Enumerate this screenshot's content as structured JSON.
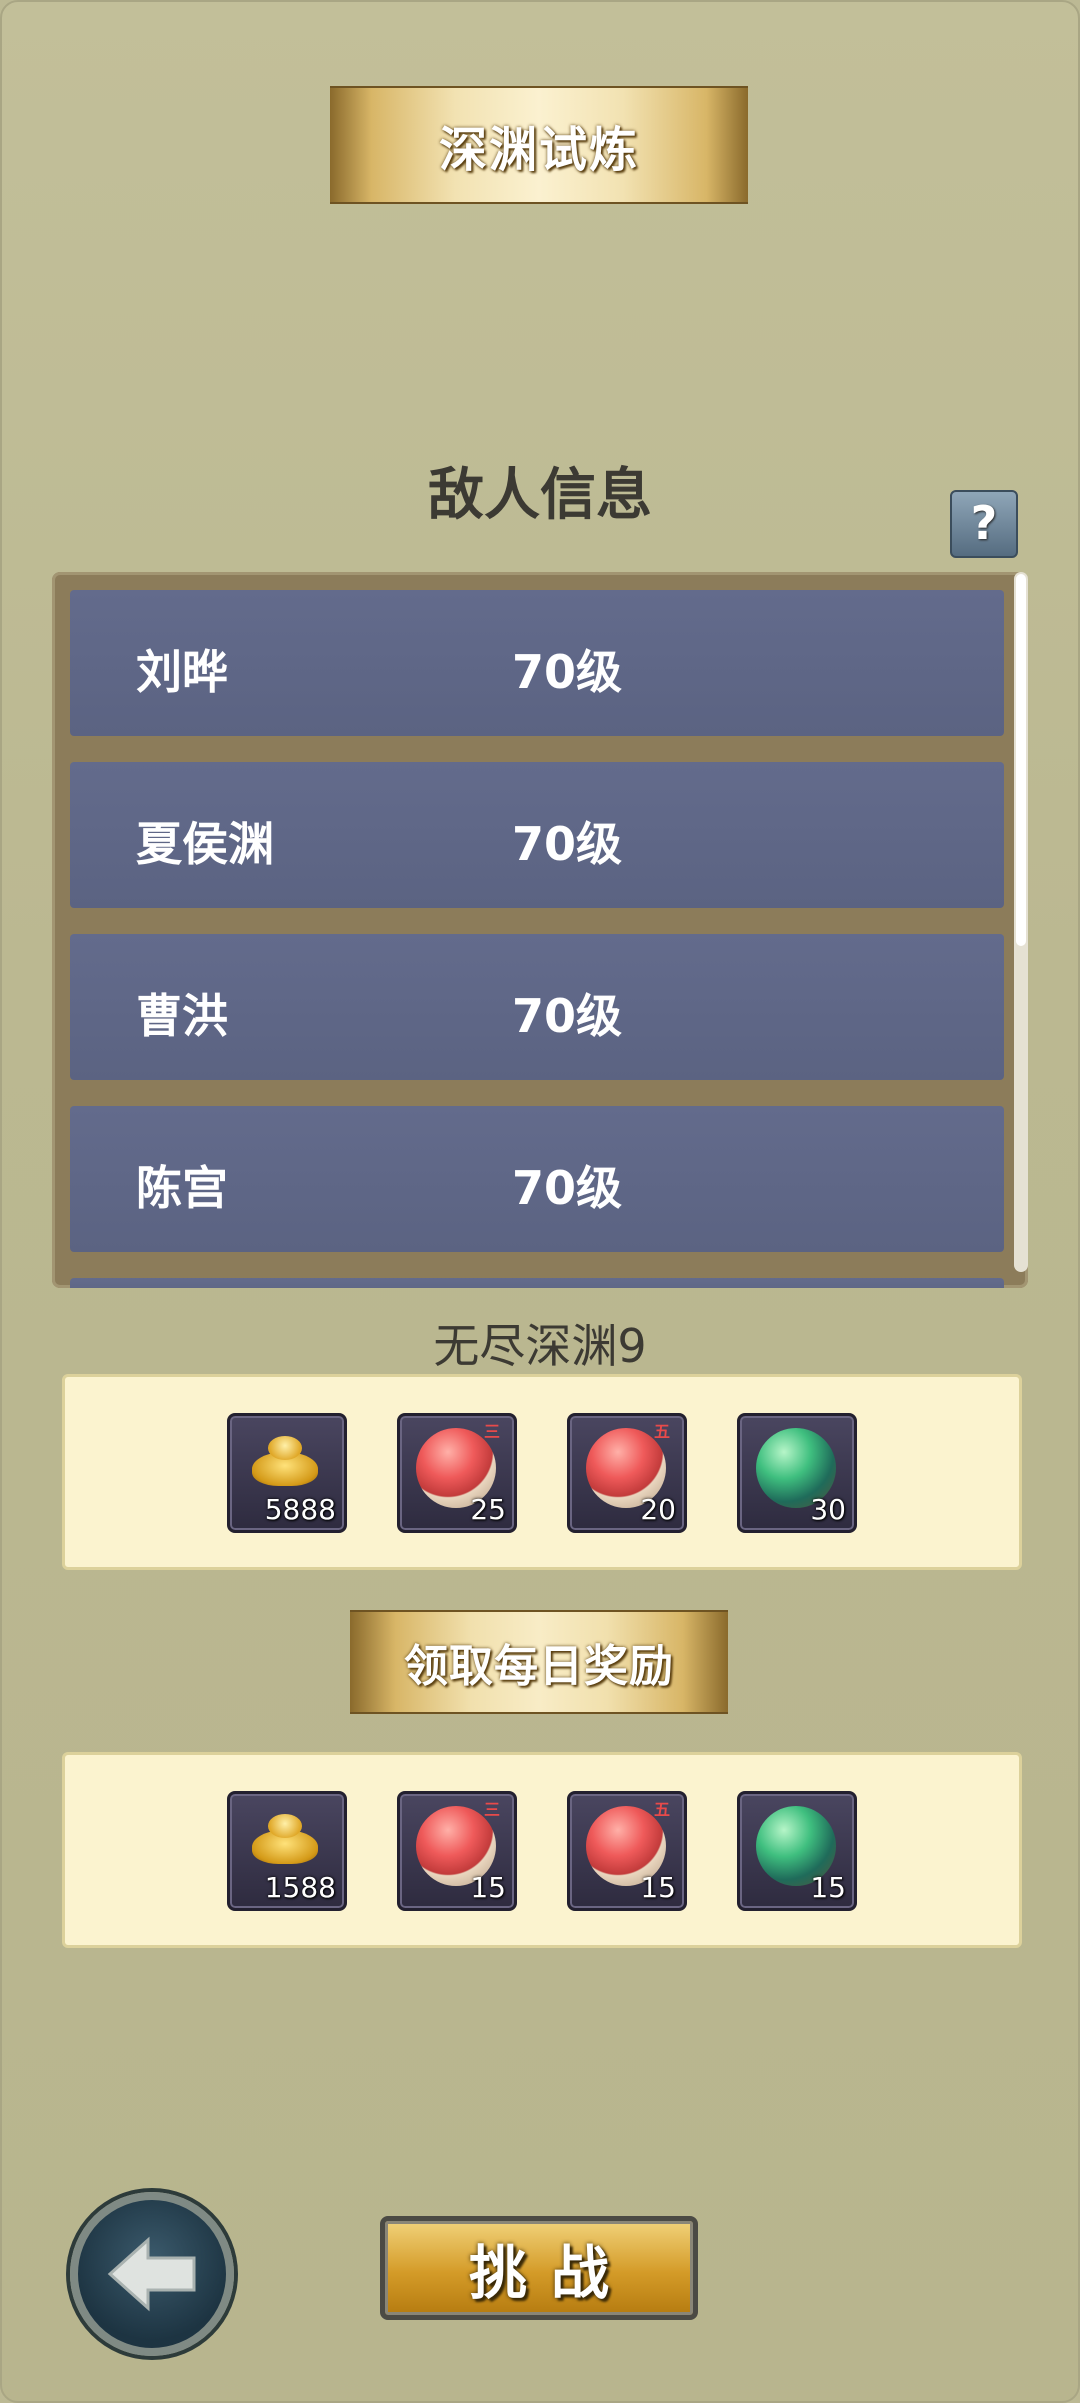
{
  "header": {
    "title": "深渊试炼"
  },
  "enemy_section": {
    "heading": "敌人信息",
    "help_label": "?",
    "enemies": [
      {
        "name": "刘晔",
        "level": "70级"
      },
      {
        "name": "夏侯渊",
        "level": "70级"
      },
      {
        "name": "曹洪",
        "level": "70级"
      },
      {
        "name": "陈宫",
        "level": "70级"
      }
    ]
  },
  "stage": {
    "title": "无尽深渊9",
    "rewards": [
      {
        "icon": "gold-ingot-icon",
        "count": "5888"
      },
      {
        "icon": "red-orb-icon",
        "count": "25"
      },
      {
        "icon": "red-orb-icon",
        "count": "20"
      },
      {
        "icon": "green-orb-icon",
        "count": "30"
      }
    ]
  },
  "daily": {
    "claim_label": "领取每日奖励",
    "rewards": [
      {
        "icon": "gold-ingot-icon",
        "count": "1588"
      },
      {
        "icon": "red-orb-icon",
        "count": "15"
      },
      {
        "icon": "red-orb-icon",
        "count": "15"
      },
      {
        "icon": "green-orb-icon",
        "count": "15"
      }
    ]
  },
  "footer": {
    "challenge_label": "挑战"
  },
  "colors": {
    "background": "#bcb994",
    "enemy_row": "#5f6787",
    "reward_box": "#fbf3cf",
    "gold_accent": "#d8b667"
  }
}
